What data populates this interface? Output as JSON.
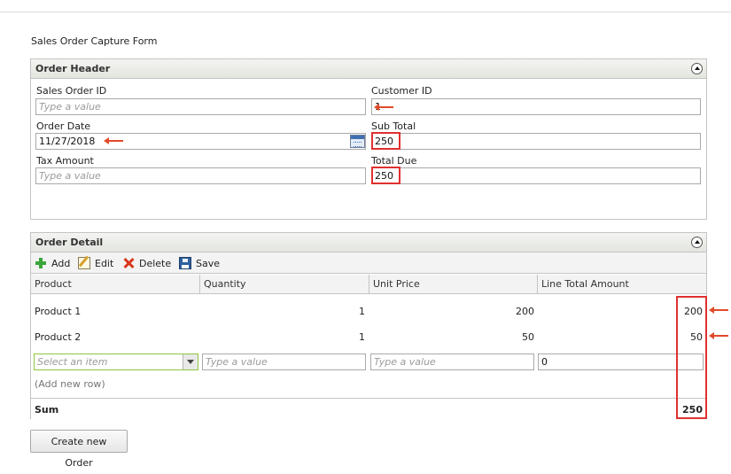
{
  "page": {
    "title": "Sales Order Capture Form"
  },
  "order_header": {
    "title": "Order Header",
    "sales_order_id": {
      "label": "Sales Order ID",
      "placeholder": "Type a value"
    },
    "customer_id": {
      "label": "Customer ID",
      "value": "1"
    },
    "order_date": {
      "label": "Order Date",
      "value": "11/27/2018"
    },
    "sub_total": {
      "label": "Sub Total",
      "value": "250"
    },
    "tax_amount": {
      "label": "Tax Amount",
      "placeholder": "Type a value"
    },
    "total_due": {
      "label": "Total Due",
      "value": "250"
    }
  },
  "order_detail": {
    "title": "Order Detail",
    "toolbar": {
      "add": "Add",
      "edit": "Edit",
      "delete": "Delete",
      "save": "Save"
    },
    "columns": [
      "Product",
      "Quantity",
      "Unit Price",
      "Line Total Amount"
    ],
    "rows": [
      {
        "product": "Product 1",
        "quantity": "1",
        "unit_price": "200",
        "line_total": "200"
      },
      {
        "product": "Product 2",
        "quantity": "1",
        "unit_price": "50",
        "line_total": "50"
      }
    ],
    "new_row": {
      "product_placeholder": "Select an item",
      "quantity_placeholder": "Type a value",
      "unit_price_placeholder": "Type a value",
      "line_total_value": "0"
    },
    "add_new_row": "(Add new row)",
    "sum_label": "Sum",
    "sum_value": "250"
  },
  "actions": {
    "create_order": "Create new Order"
  },
  "colors": {
    "highlight": "#e03030",
    "arrow": "#e04a2a",
    "accent_select": "#8ec63f"
  }
}
